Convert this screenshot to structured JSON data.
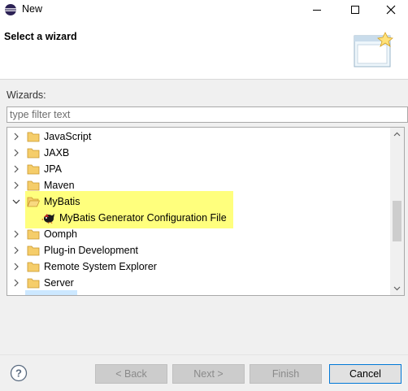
{
  "window": {
    "title": "New"
  },
  "banner": {
    "title": "Select a wizard"
  },
  "wizards": {
    "label": "Wizards:",
    "filter_placeholder": "type filter text"
  },
  "tree": {
    "items": [
      {
        "label": "JavaScript",
        "expanded": false
      },
      {
        "label": "JAXB",
        "expanded": false
      },
      {
        "label": "JPA",
        "expanded": false
      },
      {
        "label": "Maven",
        "expanded": false
      },
      {
        "label": "MyBatis",
        "expanded": true
      },
      {
        "label": "MyBatis Generator Configuration File",
        "child": true
      },
      {
        "label": "Oomph",
        "expanded": false
      },
      {
        "label": "Plug-in Development",
        "expanded": false
      },
      {
        "label": "Remote System Explorer",
        "expanded": false
      },
      {
        "label": "Server",
        "expanded": false
      }
    ]
  },
  "footer": {
    "back_label": "< Back",
    "next_label": "Next >",
    "finish_label": "Finish",
    "cancel_label": "Cancel"
  },
  "colors": {
    "highlight": "#ffff66",
    "folder": "#e8b84a",
    "accent": "#0078d7"
  },
  "icons": {
    "app": "eclipse-icon",
    "folder": "folder-icon",
    "mybatis": "mybatis-bird-icon",
    "help": "help-icon"
  }
}
